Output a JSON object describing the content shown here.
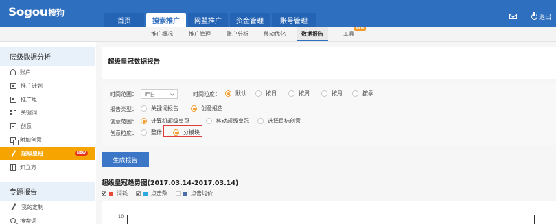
{
  "header": {
    "logo_text": "Sogou",
    "logo_cn": "搜狗",
    "main_tabs": [
      {
        "label": "首页",
        "active": false
      },
      {
        "label": "搜索推广",
        "active": true
      },
      {
        "label": "网盟推广",
        "active": false
      },
      {
        "label": "资金管理",
        "active": false
      },
      {
        "label": "账号管理",
        "active": false
      }
    ],
    "mail_icon": "mail-icon",
    "logout_label": "退出",
    "logout_icon": "power-icon"
  },
  "subnav": {
    "items": [
      {
        "label": "推广概况"
      },
      {
        "label": "推广管理"
      },
      {
        "label": "账户分析"
      },
      {
        "label": "移动优化"
      },
      {
        "label": "数据报告",
        "active": true
      },
      {
        "label": "工具",
        "badge": "NEW"
      }
    ]
  },
  "sidebar": {
    "section1_title": "层级数据分析",
    "items": [
      {
        "label": "账户",
        "icon": "person-icon"
      },
      {
        "label": "推广计划",
        "icon": "plan-icon"
      },
      {
        "label": "推广组",
        "icon": "group-icon"
      },
      {
        "label": "关键词",
        "icon": "keyword-icon"
      },
      {
        "label": "创意",
        "icon": "image-icon"
      },
      {
        "label": "附加创意",
        "icon": "addon-icon"
      },
      {
        "label": "超级皇冠",
        "icon": "pen-icon",
        "active": true,
        "badge": "NEW"
      },
      {
        "label": "知立方",
        "icon": "book-icon"
      }
    ],
    "section2_title": "专题报告",
    "items2": [
      {
        "label": "我的定制",
        "icon": "pen-icon"
      },
      {
        "label": "搜索词",
        "icon": "search-icon"
      }
    ]
  },
  "report": {
    "title": "超级皇冠数据报告",
    "time_range_label": "时间范围：",
    "time_range_value": "昨日",
    "granularity_label": "时间粒度：",
    "granularity_options": [
      {
        "label": "默认",
        "checked": true
      },
      {
        "label": "按日",
        "checked": false
      },
      {
        "label": "按周",
        "checked": false
      },
      {
        "label": "按月",
        "checked": false
      },
      {
        "label": "按季",
        "checked": false
      }
    ],
    "report_type_label": "报告类型：",
    "report_type_options": [
      {
        "label": "关键词报告",
        "checked": false
      },
      {
        "label": "创意报告",
        "checked": true
      }
    ],
    "creative_scope_label": "创意范围：",
    "creative_scope_options": [
      {
        "label": "计算机超级皇冠",
        "checked": true
      },
      {
        "label": "移动超级皇冠",
        "checked": false
      },
      {
        "label": "选择目标创意",
        "checked": false
      }
    ],
    "creative_granularity_label": "创意粒度：",
    "creative_granularity_options": [
      {
        "label": "整体",
        "checked": false
      },
      {
        "label": "分模块",
        "checked": true
      }
    ],
    "generate_button": "生成报告",
    "trend_title": "超级皇冠趋势图(2017.03.14-2017.03.14)",
    "legend": [
      {
        "label": "消耗",
        "checked": true,
        "color": "#e8473c"
      },
      {
        "label": "点击数",
        "checked": true,
        "color": "#2fa7e0"
      },
      {
        "label": "点击均价",
        "checked": false,
        "color": "#4b6ea8"
      }
    ],
    "y_top_label": "10"
  },
  "colors": {
    "brand_blue": "#2f6fbf",
    "accent_orange": "#f29a2a",
    "sidebar_active": "#f5a400",
    "button_blue": "#3b77c6"
  }
}
